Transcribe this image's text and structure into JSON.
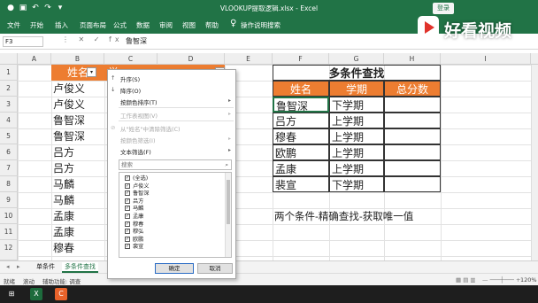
{
  "window": {
    "title": "VLOOKUP提取逻辑.xlsx - Excel",
    "login_label": "登录",
    "minimize_glyph": "—",
    "restore_glyph": "❐",
    "close_glyph": "✕"
  },
  "colors": {
    "accent": "#217346",
    "header_fill": "#ed7d31"
  },
  "watermark": {
    "text": "好看视频"
  },
  "ribbon_tabs": [
    "文件",
    "开始",
    "插入",
    "页面布局",
    "公式",
    "数据",
    "审阅",
    "视图",
    "帮助",
    "操作说明搜索"
  ],
  "formula_bar": {
    "name_box": "F3",
    "fx_icons": "⋮ ✕ ✓ fx",
    "value": "鲁智深"
  },
  "columns": [
    "A",
    "B",
    "C",
    "D",
    "E",
    "F",
    "G",
    "H",
    "I"
  ],
  "rows": [
    "1",
    "2",
    "3",
    "4",
    "5",
    "6",
    "7",
    "8",
    "9",
    "10",
    "11",
    "12"
  ],
  "left_table": {
    "header_b": "姓名",
    "header_c_fragment": "学",
    "names": [
      "卢俊义",
      "卢俊义",
      "鲁智深",
      "鲁智深",
      "吕方",
      "吕方",
      "马麟",
      "马麟",
      "孟康",
      "孟康",
      "穆春"
    ]
  },
  "right_table": {
    "title": "多条件查找",
    "headers": [
      "姓名",
      "学期",
      "总分数"
    ],
    "rows": [
      [
        "鲁智深",
        "下学期",
        ""
      ],
      [
        "吕方",
        "上学期",
        ""
      ],
      [
        "穆春",
        "上学期",
        ""
      ],
      [
        "欧鹏",
        "上学期",
        ""
      ],
      [
        "孟康",
        "上学期",
        ""
      ],
      [
        "裴宣",
        "下学期",
        ""
      ]
    ],
    "note": "两个条件-精确查找-获取唯一值"
  },
  "filter_menu": {
    "sort_asc": "升序(S)",
    "sort_desc": "降序(O)",
    "sort_by_color": "按颜色排序(T)",
    "sheet_view": "工作表视图(V)",
    "clear_filter": "从\"姓名\"中清除筛选(C)",
    "filter_by_color": "按颜色筛选(I)",
    "text_filters": "文本筛选(F)",
    "search_placeholder": "搜索",
    "items": [
      "(全选)",
      "卢俊义",
      "鲁智深",
      "吕方",
      "马麟",
      "孟康",
      "穆春",
      "穆弘",
      "欧鹏",
      "裴宣"
    ],
    "ok": "确定",
    "cancel": "取消"
  },
  "sheet_tabs": [
    "单条件",
    "多条件查找"
  ],
  "status": {
    "ready": "就绪",
    "scroll": "滚动",
    "accessibility": "辅助功能: 调查",
    "zoom": "120%"
  }
}
